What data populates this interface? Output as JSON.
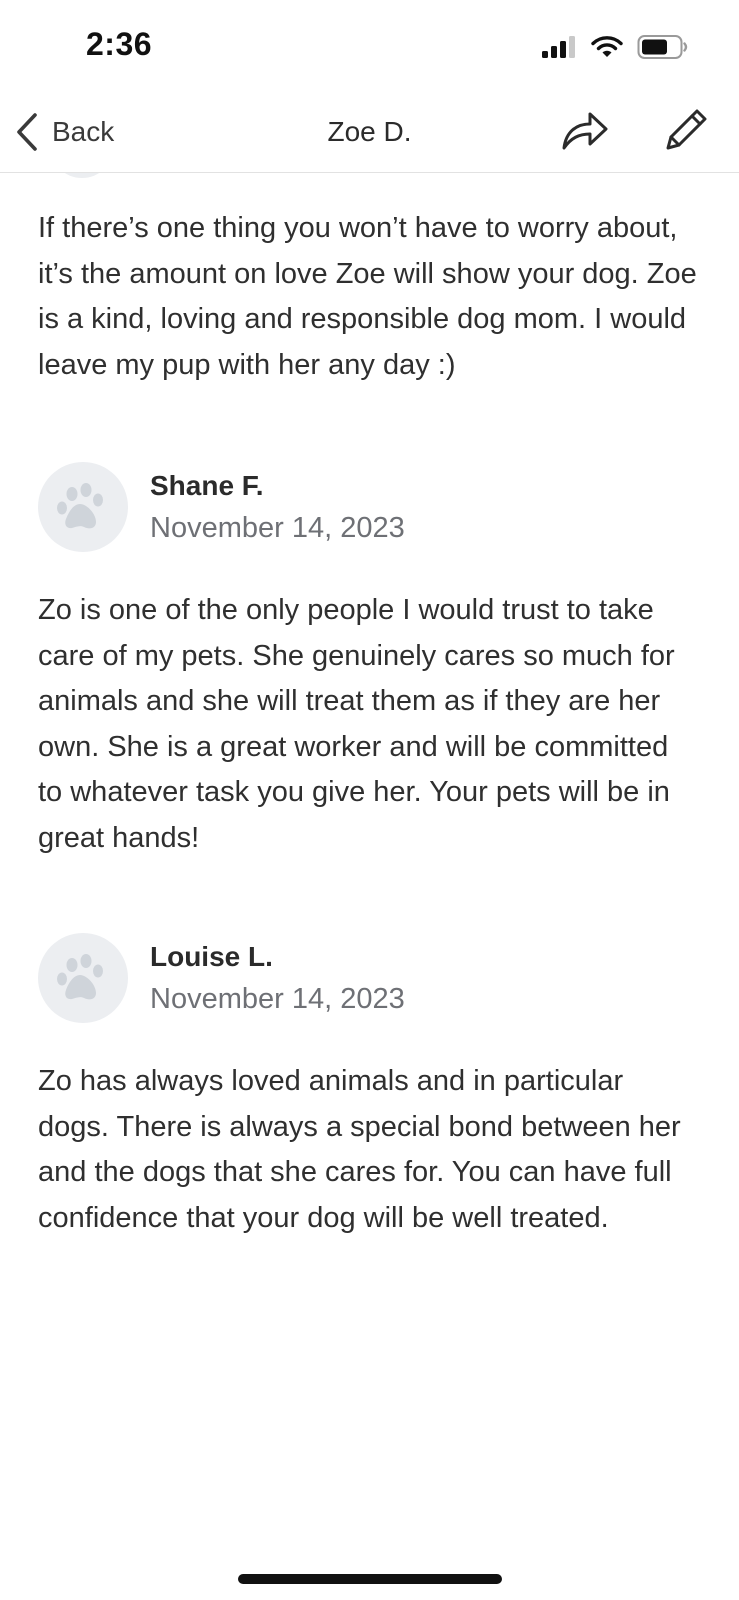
{
  "status_bar": {
    "time": "2:36",
    "icons": [
      "cellular-signal-icon",
      "wifi-icon",
      "battery-icon"
    ]
  },
  "nav": {
    "back_label": "Back",
    "title": "Zoe D.",
    "actions": [
      "share-icon",
      "edit-pencil-icon"
    ]
  },
  "reviews": [
    {
      "reviewer": "",
      "date": "",
      "text": "If there’s one thing you won’t have to worry about, it’s the amount on love Zoe will show your dog. Zoe is a kind, loving and responsible dog mom. I would leave my pup with her any day :)"
    },
    {
      "reviewer": "Shane F.",
      "date": "November 14, 2023",
      "text": "Zo is one of the only people I would trust to take care of my pets. She genuinely cares so much for animals and she will treat them as if they are her own. She is a great worker and will be committed to whatever task you give her. Your pets will be in great hands!"
    },
    {
      "reviewer": "Louise L.",
      "date": "November 14, 2023",
      "text": "Zo has always loved animals and in particular dogs.  There is always a special bond between her and the dogs that she cares for.  You can have full confidence that your dog will be well treated."
    }
  ],
  "colors": {
    "avatar_bg": "#eceef1",
    "paw": "#cfd4da",
    "date_text": "#6e7075",
    "divider": "#e2e2e2"
  }
}
